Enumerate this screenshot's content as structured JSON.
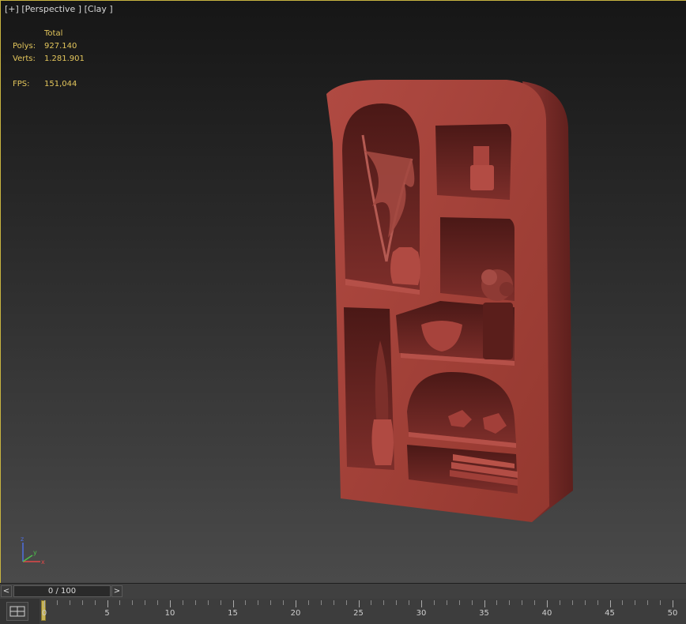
{
  "viewport": {
    "label_plus": "[+]",
    "label_view": "[Perspective ]",
    "label_shading": "[Clay ]"
  },
  "stats": {
    "total": "Total",
    "polys_label": "Polys:",
    "polys_value": "927.140",
    "verts_label": "Verts:",
    "verts_value": "1.281.901",
    "fps_label": "FPS:",
    "fps_value": "151,044"
  },
  "axis": {
    "x": "x",
    "y": "y",
    "z": "z"
  },
  "timeslider": {
    "prev": "<",
    "next": ">",
    "value": "0 / 100",
    "current_frame": 0,
    "total_frames": 100
  },
  "trackbar": {
    "ticks": [
      "0",
      "5",
      "10",
      "15",
      "20",
      "25",
      "30",
      "35",
      "40",
      "45",
      "50"
    ]
  },
  "colors": {
    "clay": "#9c3b35",
    "clay_dark": "#6e2622",
    "clay_light": "#b04a42",
    "stats_text": "#e3c65c",
    "border_active": "#c8b440"
  }
}
